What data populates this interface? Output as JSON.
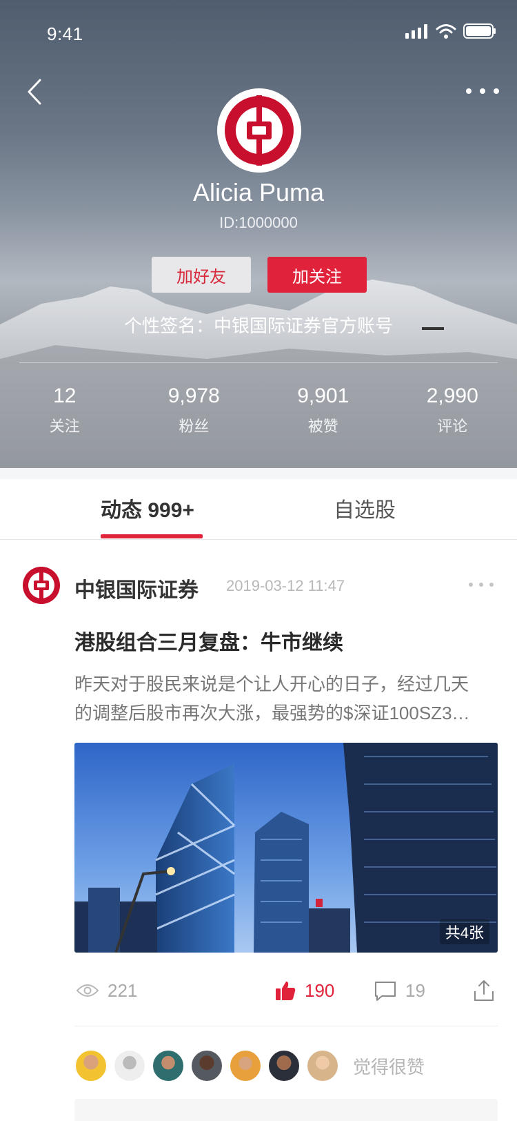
{
  "status_bar": {
    "time": "9:41"
  },
  "profile": {
    "name": "Alicia Puma",
    "id_text": "ID:1000000",
    "add_friend_label": "加好友",
    "follow_label": "加关注",
    "signature": "个性签名：中银国际证券官方账号",
    "stats": [
      {
        "value": "12",
        "label": "关注"
      },
      {
        "value": "9,978",
        "label": "粉丝"
      },
      {
        "value": "9,901",
        "label": "被赞"
      },
      {
        "value": "2,990",
        "label": "评论"
      }
    ]
  },
  "tabs": [
    {
      "label": "动态 999+",
      "active": true
    },
    {
      "label": "自选股",
      "active": false
    }
  ],
  "post": {
    "author": "中银国际证券",
    "time": "2019-03-12 11:47",
    "title": "港股组合三月复盘：牛市继续",
    "body_lines": [
      "昨天对于股民来说是个让人开心的日子，经过几天",
      "的调整后股市再次大涨，最强势的$深证100SZ3…"
    ],
    "image_count": "共4张",
    "views": "221",
    "likes": "190",
    "comments": "19",
    "likers_text": "觉得很赞"
  },
  "colors": {
    "brand_red": "#e0233b",
    "muted_gray": "#aaaaaa"
  },
  "icons": [
    "back-icon",
    "more-icon",
    "eye-icon",
    "thumbs-up-icon",
    "comment-icon",
    "share-icon",
    "signal-icon",
    "wifi-icon",
    "battery-icon"
  ]
}
